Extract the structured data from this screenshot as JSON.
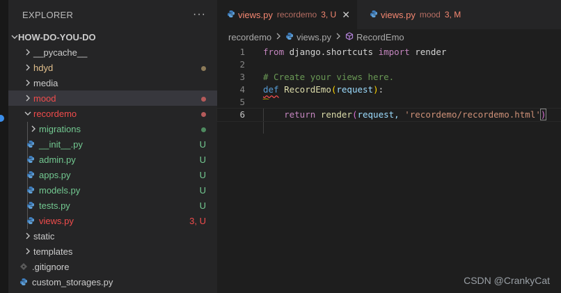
{
  "sidebar": {
    "title": "EXPLORER",
    "more_label": "···",
    "root_label": "HOW-DO-YOU-DO",
    "items": [
      {
        "label": "__pycache__",
        "decoration": ""
      },
      {
        "label": "hdyd",
        "decoration": ""
      },
      {
        "label": "media",
        "decoration": ""
      },
      {
        "label": "mood",
        "decoration": ""
      },
      {
        "label": "recordemo",
        "decoration": ""
      },
      {
        "label": "migrations",
        "decoration": ""
      },
      {
        "label": "__init__.py",
        "decoration": "U"
      },
      {
        "label": "admin.py",
        "decoration": "U"
      },
      {
        "label": "apps.py",
        "decoration": "U"
      },
      {
        "label": "models.py",
        "decoration": "U"
      },
      {
        "label": "tests.py",
        "decoration": "U"
      },
      {
        "label": "views.py",
        "decoration": "3, U"
      },
      {
        "label": "static",
        "decoration": ""
      },
      {
        "label": "templates",
        "decoration": ""
      },
      {
        "label": ".gitignore",
        "decoration": ""
      },
      {
        "label": "custom_storages.py",
        "decoration": ""
      }
    ]
  },
  "tabs": [
    {
      "name": "views.py",
      "description": "recordemo",
      "status": "3, U",
      "close": "✕"
    },
    {
      "name": "views.py",
      "description": "mood",
      "status": "3, M"
    }
  ],
  "breadcrumb": {
    "folder": "recordemo",
    "file": "views.py",
    "symbol": "RecordEmo"
  },
  "code": {
    "line_numbers": [
      "1",
      "2",
      "3",
      "4",
      "5",
      "6"
    ],
    "l1": {
      "kw1": "from",
      "mod": " django.shortcuts ",
      "kw2": "import",
      "name": " render"
    },
    "l3": {
      "comment": "# Create your views here."
    },
    "l4": {
      "kw": "def",
      "fn": "RecordEmo",
      "open": "(",
      "param": "request",
      "close": ")",
      "colon": ":"
    },
    "l6": {
      "indent": "    ",
      "kw": "return",
      "fn": " render",
      "open": "(",
      "arg": "request, ",
      "str": "'recordemo/recordemo.html'",
      "close": ")"
    }
  },
  "watermark": "CSDN @CrankyCat",
  "colors": {
    "untracked": "#73c991",
    "error": "#f14c4c",
    "modified": "#e2c08d",
    "python_icon": "#3d7ab8"
  }
}
